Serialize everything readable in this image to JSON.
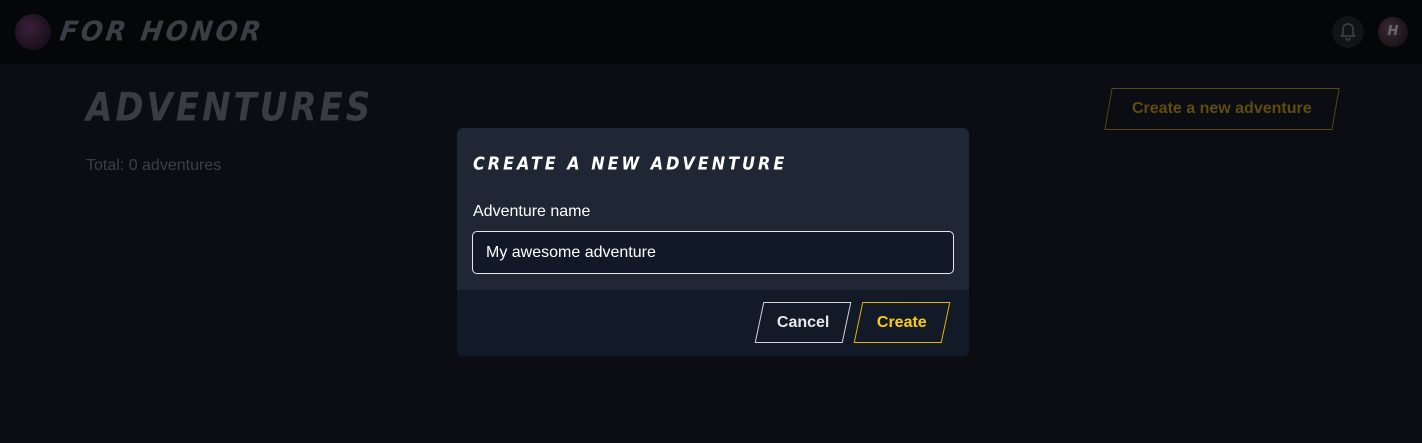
{
  "app": {
    "name": "FOR HONOR",
    "avatar_initials": "H"
  },
  "page": {
    "title": "ADVENTURES",
    "total_text": "Total: 0 adventures",
    "new_adventure_label": "Create a new adventure"
  },
  "dialog": {
    "title": "CREATE A NEW ADVENTURE",
    "field_label": "Adventure name",
    "input_value": "My awesome adventure",
    "cancel_label": "Cancel",
    "create_label": "Create"
  },
  "colors": {
    "accent": "#facc15",
    "dialog_bg": "#1f2735",
    "page_bg": "#0b0d12"
  },
  "icons": {
    "notifications": "bell-icon",
    "logo": "logo-icon"
  }
}
